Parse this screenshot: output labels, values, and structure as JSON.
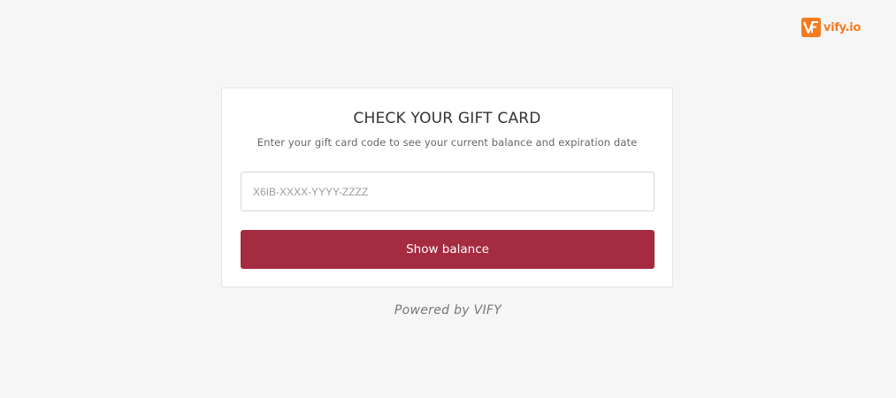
{
  "brand": {
    "logo_text": "vify.io",
    "accent_color": "#f47c20"
  },
  "card": {
    "title": "CHECK YOUR GIFT CARD",
    "subtitle": "Enter your gift card code to see your current balance and expiration date",
    "input": {
      "value": "",
      "placeholder": "X6IB-XXXX-YYYY-ZZZZ"
    },
    "submit_label": "Show balance",
    "button_color": "#a52b40"
  },
  "footer": {
    "powered_by": "Powered by VIFY"
  }
}
